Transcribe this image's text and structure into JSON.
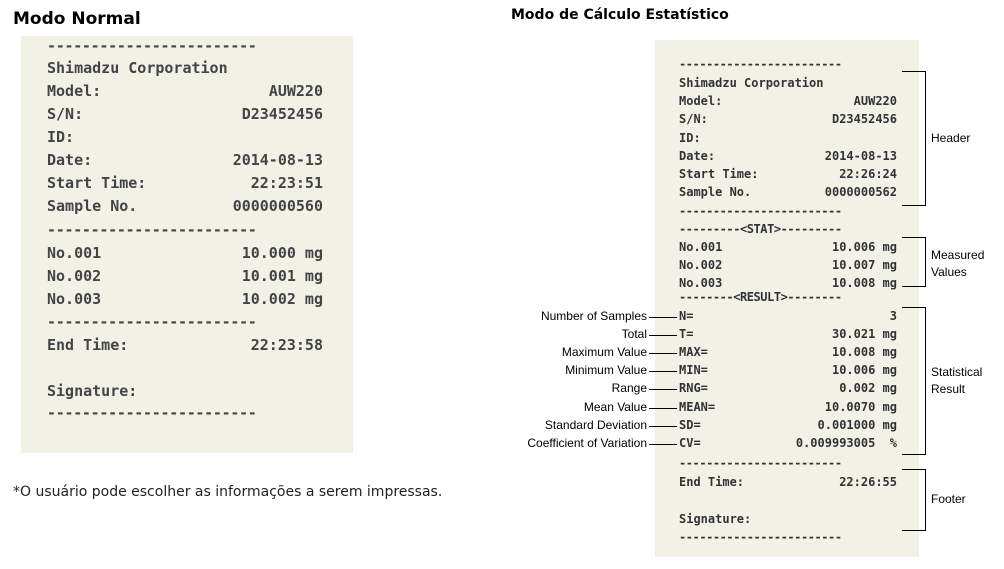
{
  "headings": {
    "normal": "Modo Normal",
    "statistical": "Modo de Cálculo Estatístico"
  },
  "normal_receipt": {
    "dashes": "------------------------",
    "company": "Shimadzu Corporation",
    "model_label": "Model:",
    "model_value": "AUW220",
    "sn_label": "S/N:",
    "sn_value": "D23452456",
    "id_label": "ID:",
    "date_label": "Date:",
    "date_value": "2014-08-13",
    "start_label": "Start Time:",
    "start_value": "22:23:51",
    "sample_label": "Sample No.",
    "sample_value": "0000000560",
    "measurements": [
      {
        "label": "No.001",
        "value": "10.000 mg"
      },
      {
        "label": "No.002",
        "value": "10.001 mg"
      },
      {
        "label": "No.003",
        "value": "10.002 mg"
      }
    ],
    "end_label": "End Time:",
    "end_value": "22:23:58",
    "signature_label": "Signature:"
  },
  "stat_receipt": {
    "dashes": "------------------------",
    "company": "Shimadzu Corporation",
    "model_label": "Model:",
    "model_value": "AUW220",
    "sn_label": "S/N:",
    "sn_value": "D23452456",
    "id_label": "ID:",
    "date_label": "Date:",
    "date_value": "2014-08-13",
    "start_label": "Start Time:",
    "start_value": "22:26:24",
    "sample_label": "Sample No.",
    "sample_value": "0000000562",
    "stat_divider": "---------<STAT>---------",
    "measurements": [
      {
        "label": "No.001",
        "value": "10.006 mg"
      },
      {
        "label": "No.002",
        "value": "10.007 mg"
      },
      {
        "label": "No.003",
        "value": "10.008 mg"
      }
    ],
    "result_divider": "--------<RESULT>--------",
    "results": [
      {
        "code": "N=",
        "value": "3",
        "annotation": "Number of Samples"
      },
      {
        "code": "T=",
        "value": "30.021 mg",
        "annotation": "Total"
      },
      {
        "code": "MAX=",
        "value": "10.008 mg",
        "annotation": "Maximum Value"
      },
      {
        "code": "MIN=",
        "value": "10.006 mg",
        "annotation": "Minimum Value"
      },
      {
        "code": "RNG=",
        "value": "0.002 mg",
        "annotation": "Range"
      },
      {
        "code": "MEAN=",
        "value": "10.0070 mg",
        "annotation": "Mean Value"
      },
      {
        "code": "SD=",
        "value": "0.001000 mg",
        "annotation": "Standard Deviation"
      },
      {
        "code": "CV=",
        "value": "0.009993005  %",
        "annotation": "Coefficient of Variation"
      }
    ],
    "end_label": "End Time:",
    "end_value": "22:26:55",
    "signature_label": "Signature:"
  },
  "brackets": {
    "header": "Header",
    "measured_1": "Measured",
    "measured_2": "Values",
    "statistical_1": "Statistical",
    "statistical_2": "Result",
    "footer": "Footer"
  },
  "note": "*O usuário pode escolher as informações a serem impressas."
}
